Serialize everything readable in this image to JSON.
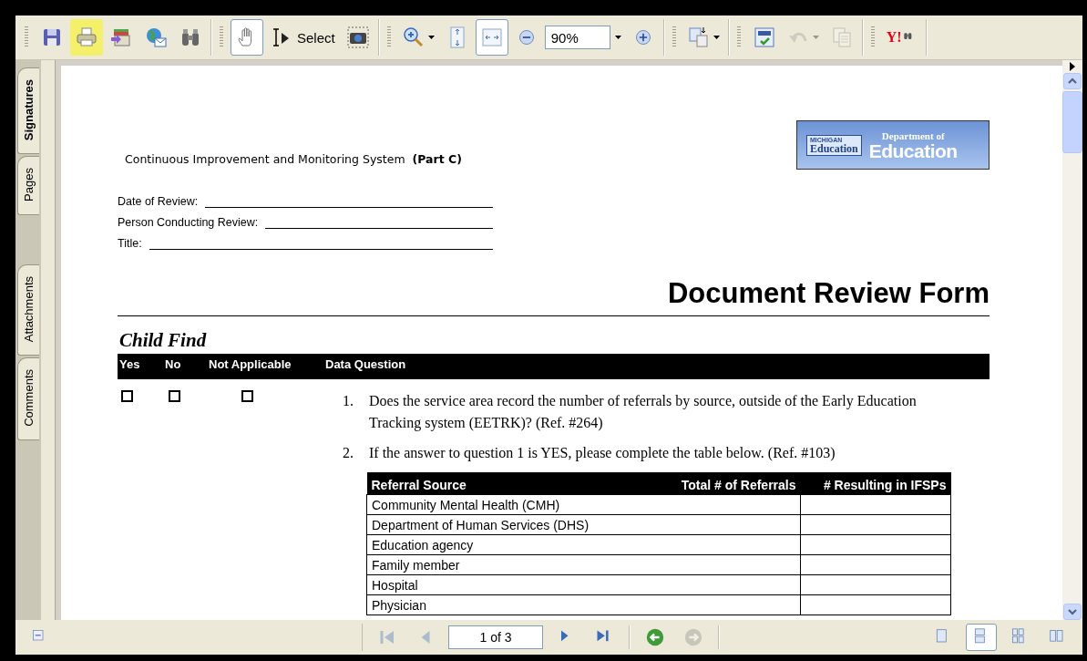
{
  "toolbar": {
    "print_highlighted": true,
    "hand_selected": true,
    "select_label": "Select",
    "fit_width_selected": true,
    "zoom_value": "90%",
    "undo_disabled": true,
    "copy_disabled": true,
    "search_brand": "Y!"
  },
  "side_tabs": [
    {
      "label": "Signatures",
      "selected": true
    },
    {
      "label": "Pages",
      "selected": false
    },
    {
      "label": "Attachments",
      "selected": false
    },
    {
      "label": "Comments",
      "selected": false
    }
  ],
  "document": {
    "header": "Continuous Improvement and Monitoring System  **(Part C)**",
    "logo": {
      "small": "MICHIGAN",
      "left": "Education",
      "top": "Department of",
      "right": "Education"
    },
    "fields": [
      {
        "label": "Date of Review:"
      },
      {
        "label": "Person Conducting Review:"
      },
      {
        "label": "Title:"
      }
    ],
    "title": "Document Review Form",
    "section": "Child Find",
    "columns": [
      "Yes",
      "No",
      "Not Applicable",
      "Data Question"
    ],
    "answers": [
      {
        "checked": false
      },
      {
        "checked": false
      },
      {
        "checked": false
      }
    ],
    "questions": [
      {
        "number": "1.",
        "text": "Does the service area record the number of referrals by source, outside of the Early Education Tracking system (EETRK)? (Ref. #264)"
      },
      {
        "number": "2.",
        "text": "If the answer to question 1 is YES, please complete the table below. (Ref. #103)"
      }
    ],
    "referral_table": {
      "columns": [
        "Referral Source",
        "Total # of Referrals",
        "# Resulting in IFSPs"
      ],
      "rows": [
        "Community Mental Health (CMH)",
        "Department of Human Services (DHS)",
        "Education agency",
        "Family member",
        "Hospital",
        "Physician"
      ]
    }
  },
  "bottom_bar": {
    "first_disabled": true,
    "prev_disabled": true,
    "page": "1 of 3",
    "next_disabled": false,
    "last_disabled": false,
    "back_disabled": false,
    "forward_disabled": true,
    "views": [
      {
        "selected": false
      },
      {
        "selected": true
      },
      {
        "selected": false
      },
      {
        "selected": false
      }
    ]
  }
}
